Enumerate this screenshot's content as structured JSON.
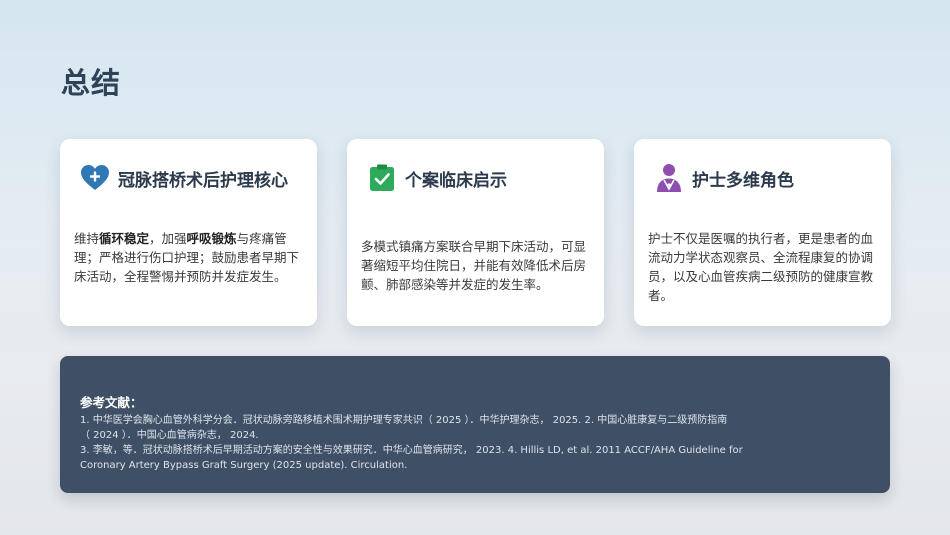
{
  "slide": {
    "title": "总结"
  },
  "cards": [
    {
      "icon": "heart-plus-icon",
      "icon_color": "#2f78b4",
      "title": "冠脉搭桥术后护理核心",
      "body": [
        {
          "text": "维持",
          "bold": false
        },
        {
          "text": "循环稳定",
          "bold": true
        },
        {
          "text": "，加强",
          "bold": false
        },
        {
          "text": "呼吸锻炼",
          "bold": true
        },
        {
          "text": "与疼痛管理；严格进行伤口护理；鼓励患者早期下床活动，全程警惕并预防并发症发生。",
          "bold": false
        }
      ]
    },
    {
      "icon": "clipboard-check-icon",
      "icon_color": "#2eaa5c",
      "title": "个案临床启示",
      "body": [
        {
          "text": "多模式镇痛方案联合早期下床活动，可显著缩短平均住院日，并能有效降低术后房颤、肺部感染等并发症的发生率。",
          "bold": false
        }
      ]
    },
    {
      "icon": "nurse-icon",
      "icon_color": "#8e4fb0",
      "title": "护士多维角色",
      "body": [
        {
          "text": "护士不仅是医嘱的执行者，更是患者的血流动力学状态观察员、全流程康复的协调员，以及心血管疾病二级预防的健康宣教者。",
          "bold": false
        }
      ]
    }
  ],
  "references": {
    "title": "参考文献：",
    "lines": [
      "1. 中华医学会胸心血管外科学分会．冠状动脉旁路移植术围术期护理专家共识（ 2025 ）．中华护理杂志， 2025.    2. 中国心脏康复与二级预防指南",
      "（ 2024 ）．中国心血管病杂志， 2024.",
      "3. 李敏，等．冠状动脉搭桥术后早期活动方案的安全性与效果研究．中华心血管病研究， 2023.    4. Hillis LD, et al. 2011 ACCF/AHA Guideline for",
      "Coronary Artery Bypass Graft Surgery (2025 update). Circulation."
    ]
  }
}
